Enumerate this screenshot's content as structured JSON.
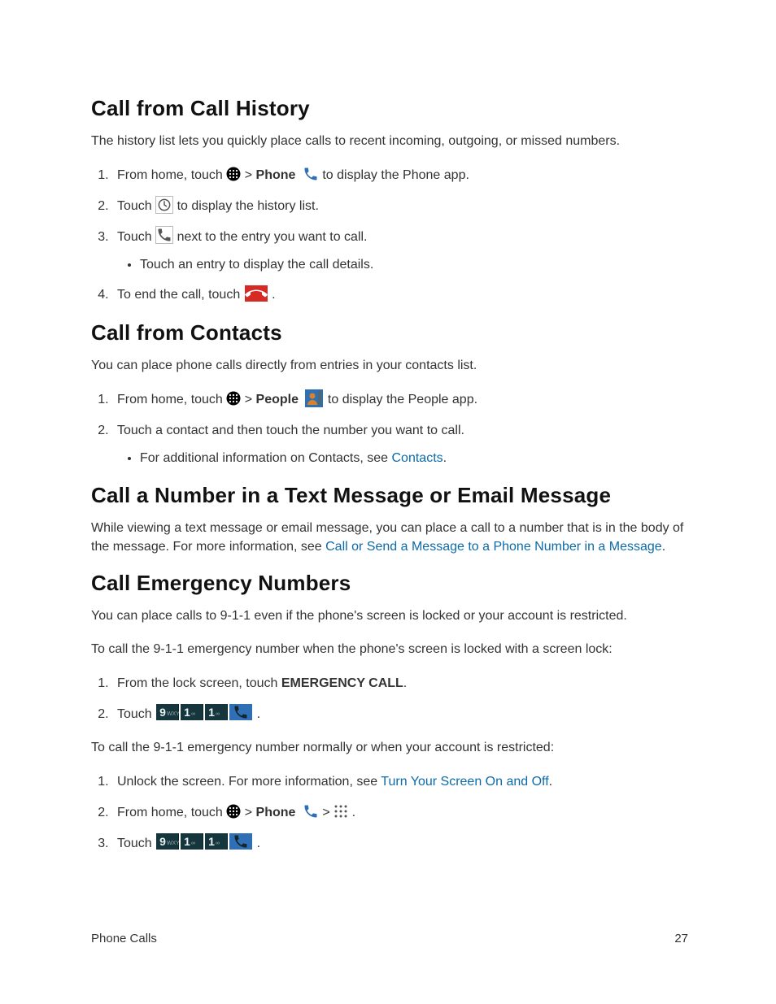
{
  "section1": {
    "heading": "Call from Call History",
    "intro": "The history list lets you quickly place calls to recent incoming, outgoing, or missed numbers.",
    "step1a": "From home, touch ",
    "step1b": " > ",
    "step1_phone": "Phone",
    "step1c": " to display the Phone app.",
    "step2a": "Touch ",
    "step2b": " to display the history list.",
    "step3a": "Touch ",
    "step3b": " next to the entry you want to call.",
    "step3_bullet": "Touch an entry to display the call details.",
    "step4a": "To end the call, touch ",
    "step4b": "."
  },
  "section2": {
    "heading": "Call from Contacts",
    "intro": "You can place phone calls directly from entries in your contacts list.",
    "step1a": "From home, touch ",
    "step1b": " > ",
    "step1_people": "People",
    "step1c": " to display the People app.",
    "step2": "Touch a contact and then touch the number you want to call.",
    "step2_bullet_a": "For additional information on Contacts, see ",
    "step2_bullet_link": "Contacts",
    "step2_bullet_b": "."
  },
  "section3": {
    "heading": "Call a Number in a Text Message or Email Message",
    "p1a": "While viewing a text message or email message, you can place a call to a number that is in the body of the message. For more information, see ",
    "p1_link": "Call or Send a Message to a Phone Number in a Message",
    "p1b": "."
  },
  "section4": {
    "heading": "Call Emergency Numbers",
    "p1": "You can place calls to 9-1-1 even if the phone's screen is locked or your account is restricted.",
    "p2": "To call the 9-1-1 emergency number when the phone's screen is locked with a screen lock:",
    "ol1_step1a": "From the lock screen, touch ",
    "ol1_step1_em": "EMERGENCY CALL",
    "ol1_step1b": ".",
    "ol1_step2a": "Touch ",
    "ol1_step2b": ".",
    "p3": "To call the 9-1-1 emergency number normally or when your account is restricted:",
    "ol2_step1a": "Unlock the screen. For more information, see ",
    "ol2_step1_link": "Turn Your Screen On and Off",
    "ol2_step1b": ".",
    "ol2_step2a": "From home, touch ",
    "ol2_step2b": " > ",
    "ol2_step2_phone": "Phone",
    "ol2_step2c": " > ",
    "ol2_step2d": " .",
    "ol2_step3a": "Touch ",
    "ol2_step3b": "."
  },
  "dialkeys": {
    "nine": "9",
    "nine_sub": "WXYZ",
    "one": "1",
    "one_sub": "∞"
  },
  "footer": {
    "left": "Phone Calls",
    "right": "27"
  }
}
